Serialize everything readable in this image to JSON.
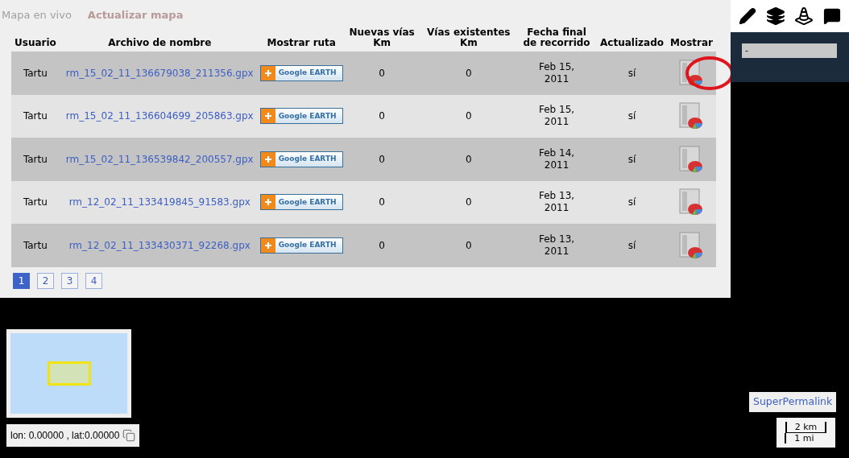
{
  "nav": [
    "Mapa en vivo",
    "Actualizar mapa"
  ],
  "table": {
    "columns": [
      "Usuario",
      "Archivo de nombre",
      "Mostrar ruta",
      "Nuevas vías Km",
      "Vías existentes Km",
      "Fecha final de recorrido",
      "Actualizado",
      "Mostrar"
    ],
    "rows": [
      {
        "user": "Tartu",
        "file": "rm_15_02_11_136679038_211356.gpx",
        "route": "Google EARTH",
        "new_km": "0",
        "existing_km": "0",
        "date": "Feb 15, 2011",
        "updated": "sí",
        "highlighted": true
      },
      {
        "user": "Tartu",
        "file": "rm_15_02_11_136604699_205863.gpx",
        "route": "Google EARTH",
        "new_km": "0",
        "existing_km": "0",
        "date": "Feb 15, 2011",
        "updated": "sí",
        "highlighted": false
      },
      {
        "user": "Tartu",
        "file": "rm_15_02_11_136539842_200557.gpx",
        "route": "Google EARTH",
        "new_km": "0",
        "existing_km": "0",
        "date": "Feb 14, 2011",
        "updated": "sí",
        "highlighted": false
      },
      {
        "user": "Tartu",
        "file": "rm_12_02_11_133419845_91583.gpx",
        "route": "Google EARTH",
        "new_km": "0",
        "existing_km": "0",
        "date": "Feb 13, 2011",
        "updated": "sí",
        "highlighted": false
      },
      {
        "user": "Tartu",
        "file": "rm_12_02_11_133430371_92268.gpx",
        "route": "Google EARTH",
        "new_km": "0",
        "existing_km": "0",
        "date": "Feb 13, 2011",
        "updated": "sí",
        "highlighted": false
      }
    ]
  },
  "pagination": [
    {
      "label": "1",
      "selected": true
    },
    {
      "label": "2",
      "selected": false
    },
    {
      "label": "3",
      "selected": false
    },
    {
      "label": "4",
      "selected": false
    }
  ],
  "layer_field": {
    "value": "-"
  },
  "coordinates": "lon: 0.00000 , lat:0.00000",
  "permalink": "SuperPermalink",
  "scale": {
    "metric": "2 km",
    "imperial": "1 mi"
  }
}
